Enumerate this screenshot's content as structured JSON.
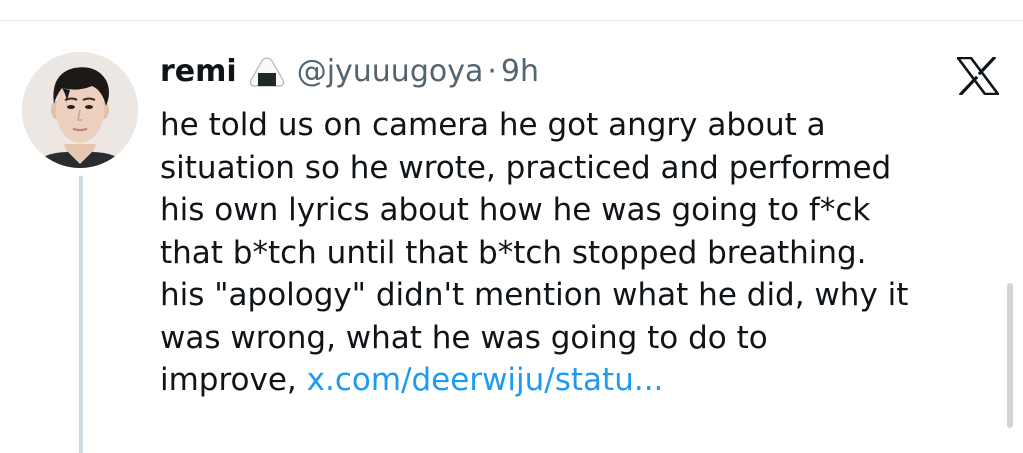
{
  "tweet": {
    "author": {
      "display_name": "remi",
      "emoji_icon": "onigiri-icon",
      "handle": "@jyuuugoya",
      "separator": "·",
      "timestamp": "9h"
    },
    "platform_icon": "x-logo-icon",
    "text_lines": [
      "he told us on camera he got angry about a",
      "situation so he wrote, practiced and performed",
      "his own lyrics about how he was going to f*ck",
      "that b*tch until that b*tch stopped breathing.",
      "his \"apology\" didn't mention what he did, why it",
      "was wrong, what he was going to do to"
    ],
    "last_line_prefix": "improve,",
    "link_text": "x.com/deerwiju/statu..."
  },
  "colors": {
    "text": "#0f1419",
    "secondary": "#536471",
    "link": "#1d9bf0",
    "thread_line": "#cfd9de"
  }
}
